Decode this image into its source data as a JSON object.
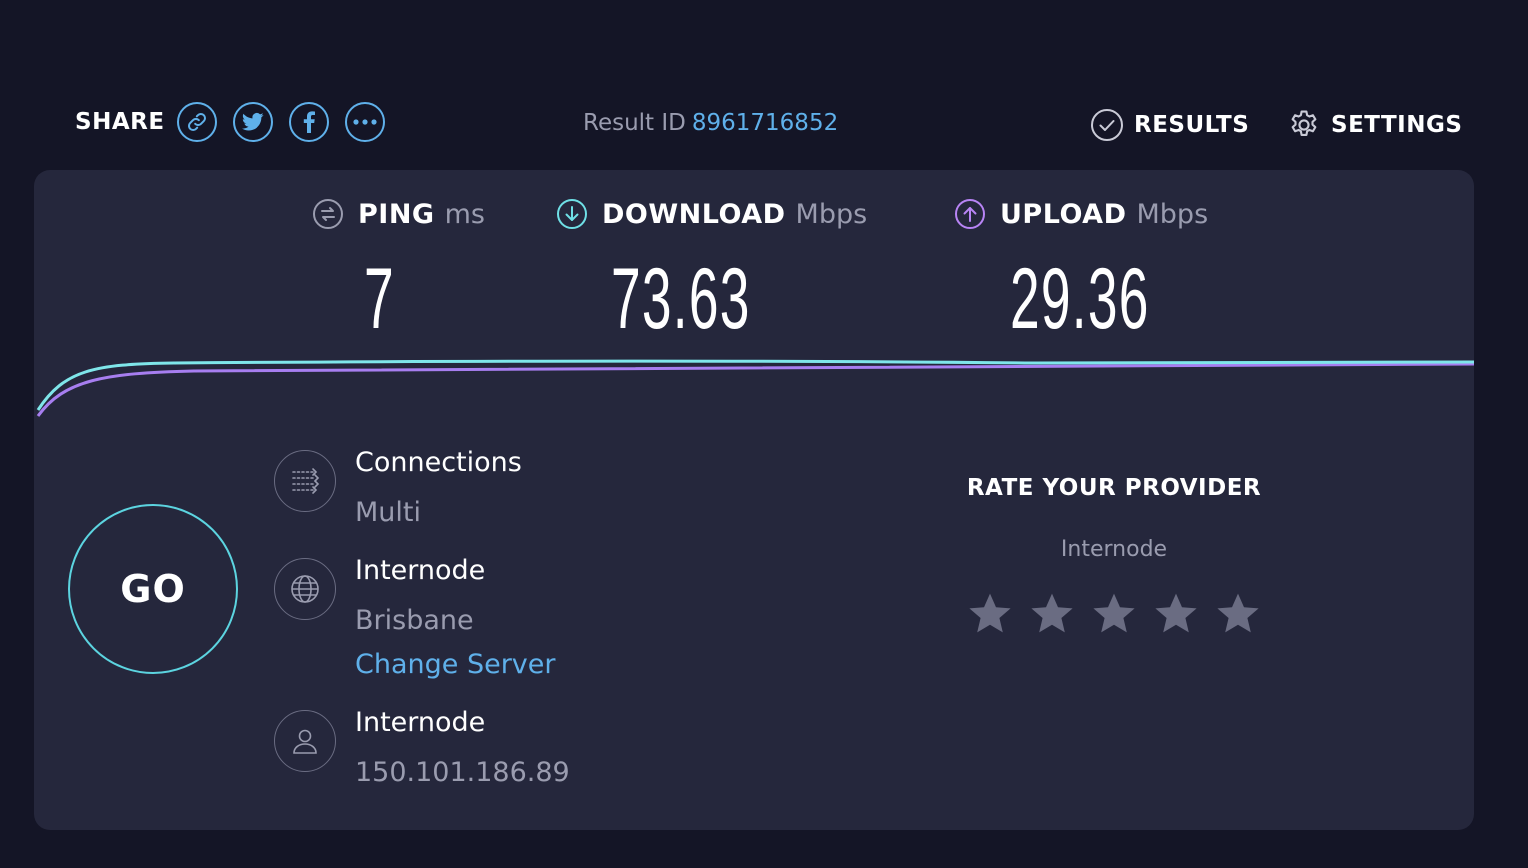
{
  "header": {
    "share_label": "SHARE",
    "share_buttons": [
      {
        "icon": "link-icon"
      },
      {
        "icon": "twitter-icon"
      },
      {
        "icon": "facebook-icon"
      },
      {
        "icon": "more-icon"
      }
    ],
    "result_id_label": "Result ID",
    "result_id_value": "8961716852",
    "results_label": "RESULTS",
    "settings_label": "SETTINGS"
  },
  "metrics": {
    "ping": {
      "label": "PING",
      "unit": "ms",
      "value": "7",
      "icon": "ping-icon",
      "color": "#9a9caf"
    },
    "download": {
      "label": "DOWNLOAD",
      "unit": "Mbps",
      "value": "73.63",
      "icon": "download-arrow-icon",
      "color": "#6fe0e6"
    },
    "upload": {
      "label": "UPLOAD",
      "unit": "Mbps",
      "value": "29.36",
      "icon": "upload-arrow-icon",
      "color": "#b884f5"
    }
  },
  "go_label": "GO",
  "connection": {
    "title": "Connections",
    "value": "Multi",
    "icon": "connections-icon"
  },
  "server": {
    "title": "Internode",
    "location": "Brisbane",
    "change_link": "Change Server",
    "icon": "globe-icon"
  },
  "isp": {
    "title": "Internode",
    "ip": "150.101.186.89",
    "icon": "user-icon"
  },
  "rating": {
    "title": "RATE YOUR PROVIDER",
    "provider": "Internode",
    "stars": 5,
    "star_color": "#6a6c82"
  },
  "colors": {
    "accent": "#5fb0ea",
    "background": "#141526",
    "panel": "#25273c"
  }
}
